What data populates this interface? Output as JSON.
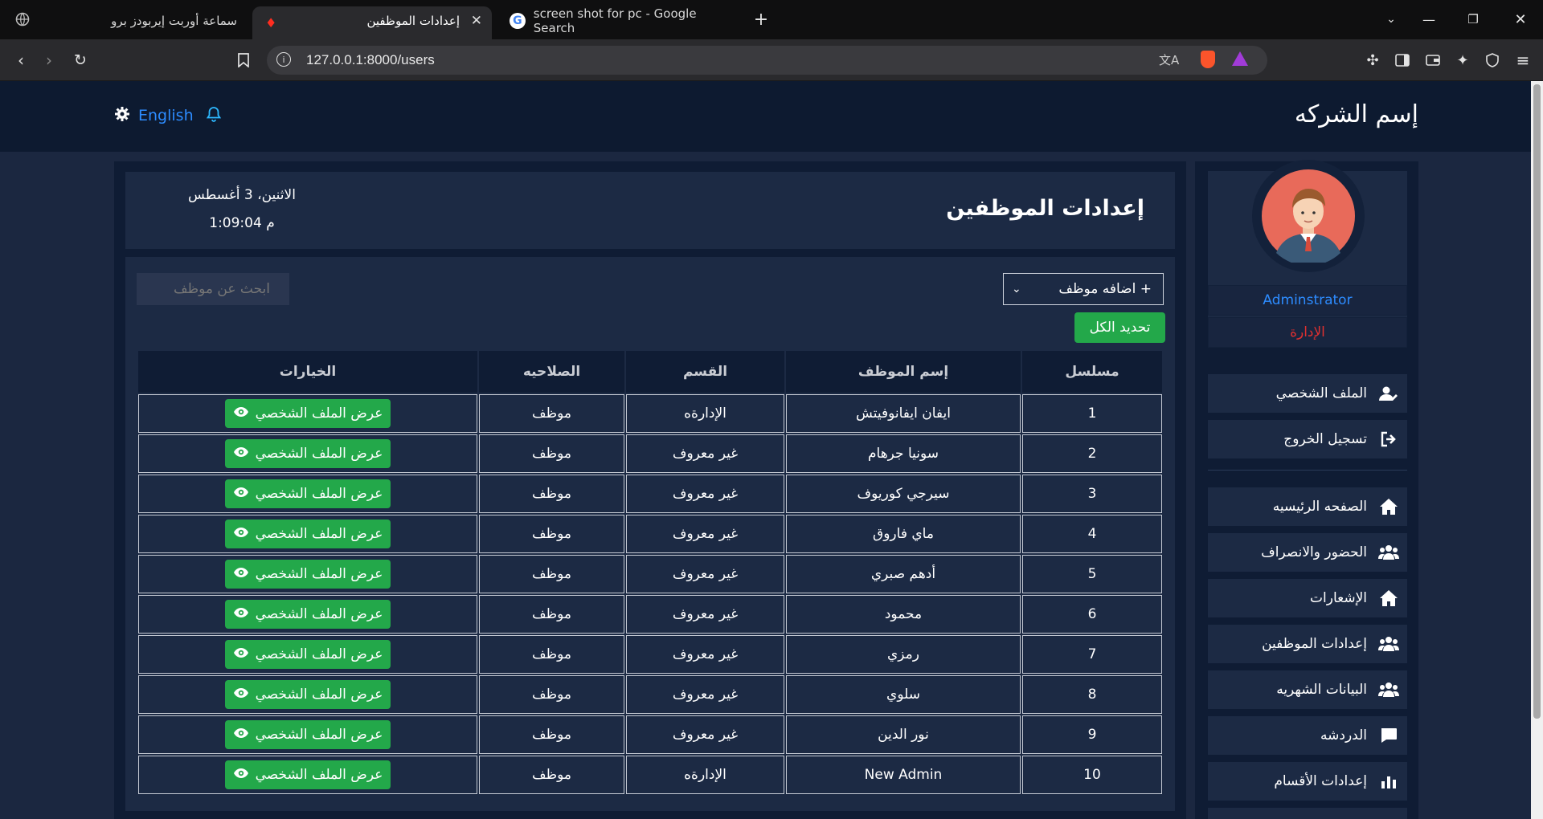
{
  "browser": {
    "tabs": [
      {
        "title": "سماعة أوربت إيربودز برو"
      },
      {
        "title": "إعدادات الموظفين"
      },
      {
        "title": "screen shot for pc - Google Search"
      }
    ],
    "url": "127.0.0.1:8000/users"
  },
  "header": {
    "brand": "إسم الشركه",
    "language": "English"
  },
  "sidebar": {
    "user_name": "Adminstrator",
    "user_role": "الإدارة",
    "account_items": [
      {
        "label": "الملف الشخصي",
        "icon": "user-edit-icon"
      },
      {
        "label": "تسجيل الخروج",
        "icon": "logout-icon"
      }
    ],
    "nav_items": [
      {
        "label": "الصفحه الرئيسيه",
        "icon": "home-icon"
      },
      {
        "label": "الحضور والانصراف",
        "icon": "users-icon"
      },
      {
        "label": "الإشعارات",
        "icon": "home-icon"
      },
      {
        "label": "إعدادات الموظفين",
        "icon": "users-icon"
      },
      {
        "label": "البيانات الشهريه",
        "icon": "users-icon"
      },
      {
        "label": "الدردشه",
        "icon": "chat-icon"
      },
      {
        "label": "إعدادات الأقسام",
        "icon": "bar-chart-icon"
      }
    ]
  },
  "page": {
    "title": "إعدادات الموظفين",
    "date": "الاثنين، 3 أغسطس",
    "time": "1:09:04 م",
    "search_placeholder": "ابحث عن موظف",
    "add_employee": "اضافه موظف +",
    "select_all": "تحديد الكل"
  },
  "table": {
    "headers": [
      "مسلسل",
      "إسم الموظف",
      "القسم",
      "الصلاحيه",
      "الخيارات"
    ],
    "view_label": "عرض الملف الشخصي",
    "rows": [
      {
        "no": "1",
        "name": "ايفان ايفانوفيتش",
        "dept": "الإدارةه",
        "role": "موظف"
      },
      {
        "no": "2",
        "name": "سونيا جرهام",
        "dept": "غير معروف",
        "role": "موظف"
      },
      {
        "no": "3",
        "name": "سيرجي كوريوف",
        "dept": "غير معروف",
        "role": "موظف"
      },
      {
        "no": "4",
        "name": "ماي فاروق",
        "dept": "غير معروف",
        "role": "موظف"
      },
      {
        "no": "5",
        "name": "أدهم صبري",
        "dept": "غير معروف",
        "role": "موظف"
      },
      {
        "no": "6",
        "name": "محمود",
        "dept": "غير معروف",
        "role": "موظف"
      },
      {
        "no": "7",
        "name": "رمزي",
        "dept": "غير معروف",
        "role": "موظف"
      },
      {
        "no": "8",
        "name": "سلوي",
        "dept": "غير معروف",
        "role": "موظف"
      },
      {
        "no": "9",
        "name": "نور الدين",
        "dept": "غير معروف",
        "role": "موظف"
      },
      {
        "no": "10",
        "name": "New Admin",
        "dept": "الإدارةه",
        "role": "موظف"
      }
    ]
  },
  "colors": {
    "accent_green": "#23a84a",
    "link_blue": "#2d8cff",
    "role_red": "#e03030",
    "bg": "#1b2740"
  }
}
